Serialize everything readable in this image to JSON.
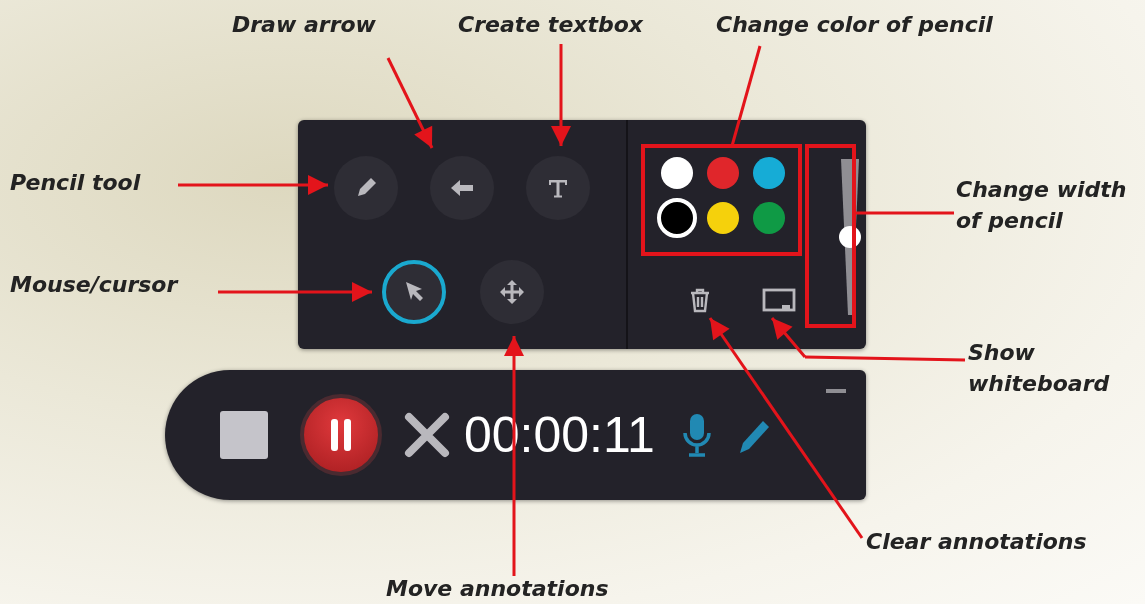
{
  "annotations": [
    {
      "text": "Draw arrow"
    },
    {
      "text": "Create textbox"
    },
    {
      "text": "Change color of pencil"
    },
    {
      "text": "Pencil tool"
    },
    {
      "text": "Change width of pencil"
    },
    {
      "text": "Mouse/cursor"
    },
    {
      "text": "Show whiteboard"
    },
    {
      "text": "Clear annotations"
    },
    {
      "text": "Move annotations"
    }
  ],
  "annotation_panel": {
    "tools": [
      {
        "kind": "pencil",
        "selected": false
      },
      {
        "kind": "arrow",
        "selected": false
      },
      {
        "kind": "text",
        "selected": false
      },
      {
        "kind": "cursor",
        "selected": true
      },
      {
        "kind": "move",
        "selected": false
      }
    ],
    "colors": [
      {
        "color": "#ffffff",
        "selected": false
      },
      {
        "color": "#e0262b",
        "selected": false
      },
      {
        "color": "#16acd6",
        "selected": false
      },
      {
        "color": "#000000",
        "selected": true
      },
      {
        "color": "#f5d10c",
        "selected": false
      },
      {
        "color": "#0f9a45",
        "selected": false
      }
    ],
    "width": {
      "level": 0.5
    }
  },
  "recorder": {
    "timer": "00:00:11",
    "mic_on": true,
    "annotate_on": true
  }
}
